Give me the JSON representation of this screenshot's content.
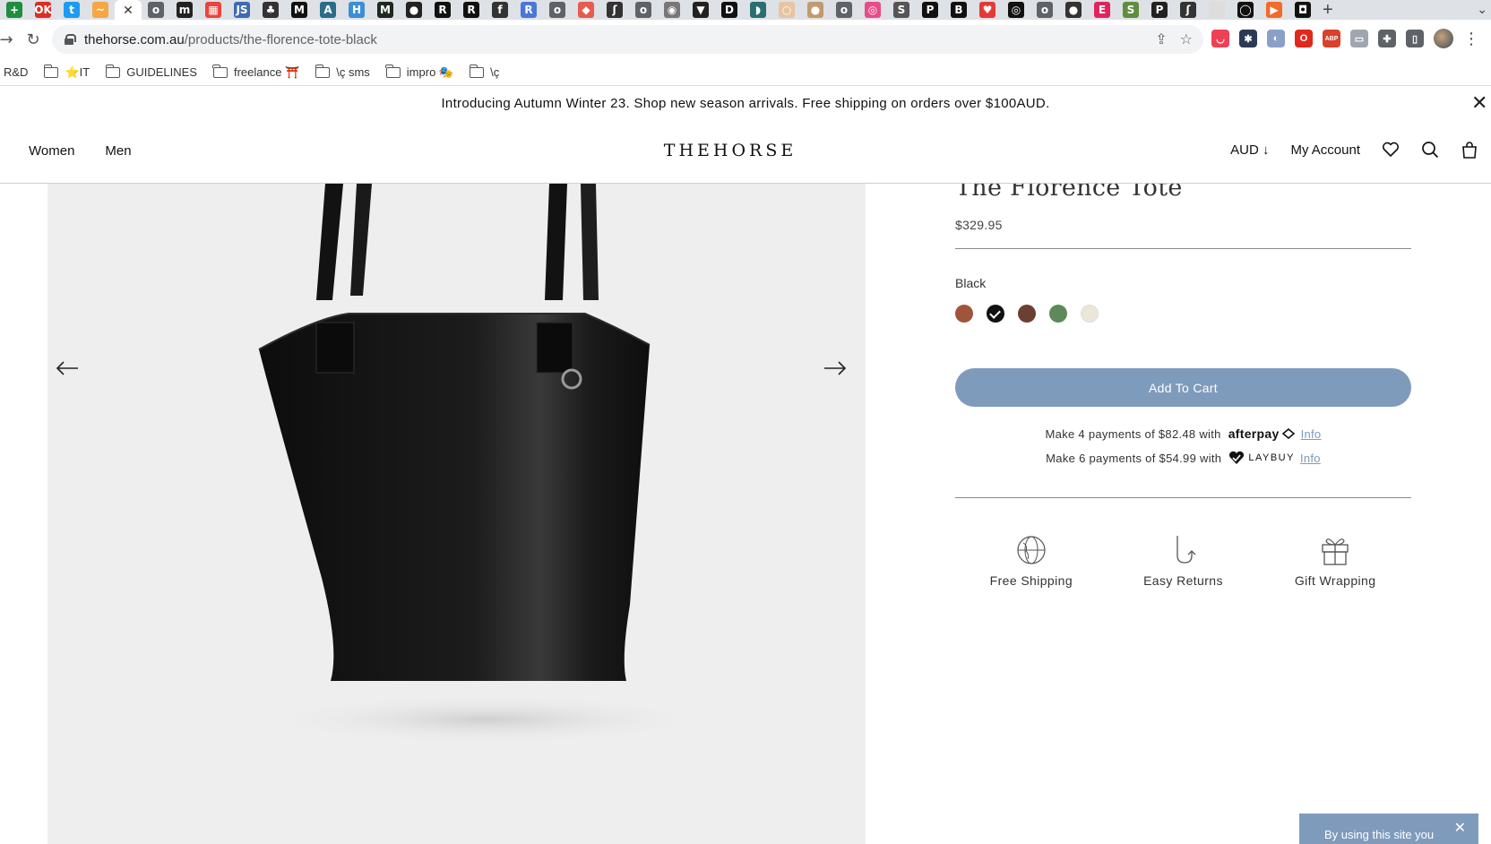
{
  "browser": {
    "tabs": [
      {
        "icon": "sheets-icon",
        "color": "#1e8e3e",
        "glyph": "+"
      },
      {
        "icon": "ok-icon",
        "color": "#d93025",
        "glyph": "OK"
      },
      {
        "icon": "twitter-icon",
        "color": "#1d9bf0",
        "glyph": "t"
      },
      {
        "icon": "sms-icon",
        "color": "#f4a742",
        "glyph": "~"
      },
      {
        "icon": "globe-icon",
        "color": "#5f6368",
        "glyph": "o"
      },
      {
        "icon": "m-icon",
        "color": "#222222",
        "glyph": "m"
      },
      {
        "icon": "tiles-icon",
        "color": "#e8453c",
        "glyph": "▦"
      },
      {
        "icon": "js-icon",
        "color": "#3f6ab3",
        "glyph": "JS"
      },
      {
        "icon": "leaf-icon",
        "color": "#333333",
        "glyph": "♣"
      },
      {
        "icon": "medium-icon",
        "color": "#111111",
        "glyph": "M"
      },
      {
        "icon": "book-icon",
        "color": "#2b6c8a",
        "glyph": "A"
      },
      {
        "icon": "h-icon",
        "color": "#3c8ed8",
        "glyph": "H"
      },
      {
        "icon": "mj-icon",
        "color": "#1f2a1f",
        "glyph": "M"
      },
      {
        "icon": "shield-icon",
        "color": "#222222",
        "glyph": "●"
      },
      {
        "icon": "r-italic-icon",
        "color": "#111111",
        "glyph": "R"
      },
      {
        "icon": "r-circle-icon",
        "color": "#111111",
        "glyph": "R"
      },
      {
        "icon": "f-icon",
        "color": "#333333",
        "glyph": "f"
      },
      {
        "icon": "r-blue-icon",
        "color": "#4a78d8",
        "glyph": "R"
      },
      {
        "icon": "globe-icon",
        "color": "#5f6368",
        "glyph": "o"
      },
      {
        "icon": "diamond-icon",
        "color": "#e65c4f",
        "glyph": "◆"
      },
      {
        "icon": "script-icon",
        "color": "#333333",
        "glyph": "ʃ"
      },
      {
        "icon": "globe-icon",
        "color": "#5f6368",
        "glyph": "o"
      },
      {
        "icon": "pill-icon",
        "color": "#777777",
        "glyph": "◉"
      },
      {
        "icon": "pocket-icon",
        "color": "#222222",
        "glyph": "▼"
      },
      {
        "icon": "d-icon",
        "color": "#111111",
        "glyph": "D"
      },
      {
        "icon": "cup-icon",
        "color": "#2a6f6f",
        "glyph": "◗"
      },
      {
        "icon": "bulb-icon",
        "color": "#e8c4a0",
        "glyph": "○"
      },
      {
        "icon": "pin-icon",
        "color": "#c39a6b",
        "glyph": "●"
      },
      {
        "icon": "globe-icon",
        "color": "#5f6368",
        "glyph": "o"
      },
      {
        "icon": "dribbble-icon",
        "color": "#e84c88",
        "glyph": "◎"
      },
      {
        "icon": "s-icon",
        "color": "#555555",
        "glyph": "S"
      },
      {
        "icon": "pt-icon",
        "color": "#111111",
        "glyph": "P"
      },
      {
        "icon": "b-icon",
        "color": "#111111",
        "glyph": "B"
      },
      {
        "icon": "heart-icon",
        "color": "#e53935",
        "glyph": "♥"
      },
      {
        "icon": "target-icon",
        "color": "#111111",
        "glyph": "◎"
      },
      {
        "icon": "globe-icon",
        "color": "#5f6368",
        "glyph": "o"
      },
      {
        "icon": "elephant-icon",
        "color": "#333333",
        "glyph": "●"
      },
      {
        "icon": "e-icon",
        "color": "#e0245e",
        "glyph": "E"
      },
      {
        "icon": "shopify-icon",
        "color": "#5e8e3e",
        "glyph": "S"
      },
      {
        "icon": "p-circle-icon",
        "color": "#222222",
        "glyph": "P"
      },
      {
        "icon": "script-icon",
        "color": "#333333",
        "glyph": "ʃ"
      },
      {
        "icon": "blank-icon",
        "color": "#dddddd",
        "glyph": ""
      },
      {
        "icon": "github-icon",
        "color": "#111111",
        "glyph": "◯"
      },
      {
        "icon": "orange-icon",
        "color": "#f26b2a",
        "glyph": "▶"
      },
      {
        "icon": "camera-icon",
        "color": "#111111",
        "glyph": "◘"
      }
    ],
    "active_tab_close": "✕",
    "new_tab": "+",
    "url_host": "thehorse.com.au",
    "url_path": "/products/the-florence-tote-black",
    "bookmarks": [
      "R&D",
      "⭐IT",
      "GUIDELINES",
      "freelance ⛩️",
      "\\ç sms",
      "impro 🎭",
      "\\ç"
    ],
    "extensions": [
      {
        "icon": "pocket-ext-icon",
        "color": "#ef4056",
        "glyph": "◡"
      },
      {
        "icon": "react-ext-icon",
        "color": "#2b3a55",
        "glyph": "✱"
      },
      {
        "icon": "blur-ext-icon",
        "color": "#8aa0c8",
        "glyph": "◐"
      },
      {
        "icon": "opera-ext-icon",
        "color": "#e0281f",
        "glyph": "O"
      },
      {
        "icon": "abp-ext-icon",
        "color": "#d9412b",
        "glyph": "ABP"
      },
      {
        "icon": "screen-ext-icon",
        "color": "#a0a6b0",
        "glyph": "▭"
      },
      {
        "icon": "puzzle-ext-icon",
        "color": "#5f6368",
        "glyph": "✚"
      },
      {
        "icon": "sidepanel-ext-icon",
        "color": "#5f6368",
        "glyph": "▯"
      }
    ]
  },
  "site": {
    "announcement": "Introducing Autumn Winter 23. Shop new season arrivals. Free shipping on orders over $100AUD.",
    "announcement_close": "✕",
    "nav_left": [
      "Women",
      "Men"
    ],
    "logo": "THEHORSE",
    "currency": "AUD ↓",
    "account": "My Account"
  },
  "product": {
    "title": "The Florence Tote",
    "price": "$329.95",
    "color_label": "Black",
    "swatches": [
      {
        "name": "tan",
        "color": "#a0543c",
        "selected": false
      },
      {
        "name": "black",
        "color": "#111111",
        "selected": true
      },
      {
        "name": "brown",
        "color": "#6b4030",
        "selected": false
      },
      {
        "name": "green",
        "color": "#5e8a5a",
        "selected": false
      },
      {
        "name": "cream",
        "color": "#ece6d8",
        "selected": false
      }
    ],
    "add_to_cart": "Add To Cart",
    "afterpay_text": "Make 4 payments of $82.48 with",
    "afterpay_logo": "afterpay",
    "laybuy_text": "Make 6 payments of $54.99 with",
    "laybuy_logo": "LAYBUY",
    "info_label": "Info",
    "perks": [
      {
        "icon": "globe-icon",
        "label": "Free Shipping"
      },
      {
        "icon": "return-arrow-icon",
        "label": "Easy Returns"
      },
      {
        "icon": "gift-icon",
        "label": "Gift Wrapping"
      }
    ]
  },
  "cookie": {
    "text": "By using this site you",
    "close": "✕"
  },
  "colors": {
    "accent": "#7f9bbc",
    "gallery_bg": "#eeeeee",
    "bag": "#161616"
  }
}
